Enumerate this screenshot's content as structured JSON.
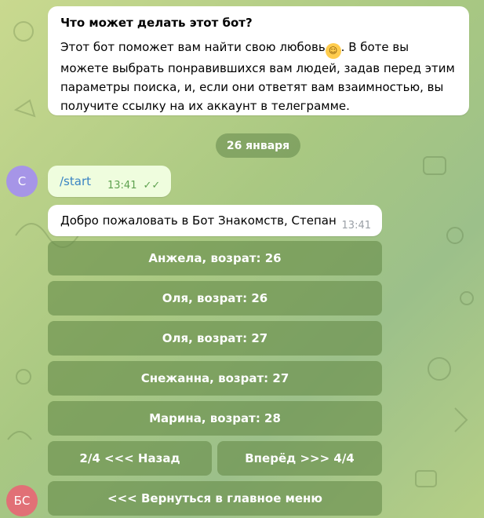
{
  "info": {
    "title": "Что может делать этот бот?",
    "text_before": "Этот бот поможет вам найти свою любовь",
    "emoji": "☺",
    "text_after": ". В боте вы можете выбрать понравившихся вам людей, задав перед этим параметры поиска, и, если они ответят вам взаимностью, вы получите ссылку на их аккаунт в телеграмме."
  },
  "date_divider": "26 января",
  "user_avatar": "С",
  "outgoing": {
    "text": "/start",
    "time": "13:41",
    "status": "✓✓"
  },
  "welcome": {
    "text": "Добро пожаловать в Бот Знакомств, Степан",
    "time": "13:41"
  },
  "keyboard": {
    "profiles": [
      "Анжела, возрат: 26",
      "Оля, возрат: 26",
      "Оля, возрат: 27",
      "Снежанна, возрат: 27",
      "Марина, возрат: 28"
    ],
    "prev": "2/4 <<< Назад",
    "next": "Вперёд >>> 4/4",
    "back": "<<< Вернуться в главное меню"
  },
  "bot_avatar": "БС",
  "colors": {
    "outgoing_bg": "#effdde",
    "link": "#3a84c4",
    "button_bg": "#688d4a"
  }
}
